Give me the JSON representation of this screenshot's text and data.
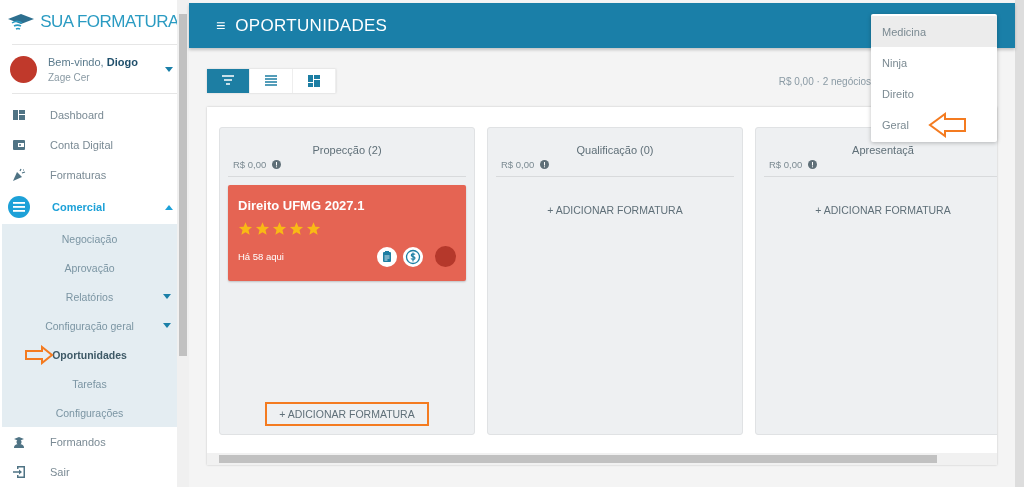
{
  "sidebar": {
    "logo": "SUA FORMATURA",
    "user": {
      "greeting": "Bem-vindo, **Diogo**",
      "company": "Zage Cer"
    },
    "items": [
      {
        "label": "Dashboard",
        "selected": false
      },
      {
        "label": "Conta Digital",
        "selected": false
      },
      {
        "label": "Formaturas",
        "selected": false
      },
      {
        "label": "Comercial",
        "expanded": true,
        "selected": true,
        "children": [
          {
            "label": "Negociação",
            "selected": false,
            "has_submenu": false,
            "annotated": false
          },
          {
            "label": "Aprovação",
            "selected": false,
            "has_submenu": false,
            "annotated": false
          },
          {
            "label": "Relatórios",
            "selected": false,
            "has_submenu": true,
            "annotated": false
          },
          {
            "label": "Configuração geral",
            "selected": false,
            "has_submenu": true,
            "annotated": false
          },
          {
            "label": "Oportunidades",
            "selected": true,
            "has_submenu": false,
            "annotated": true
          },
          {
            "label": "Tarefas",
            "selected": false,
            "has_submenu": false,
            "annotated": false
          },
          {
            "label": "Configurações",
            "selected": false,
            "has_submenu": false,
            "annotated": false
          }
        ]
      },
      {
        "label": "Formandos",
        "selected": false
      },
      {
        "label": "Sair",
        "selected": false
      }
    ]
  },
  "header": {
    "menu_icon": "≡",
    "title": "OPORTUNIDADES"
  },
  "view_toggle": [
    {
      "selected": true
    },
    {
      "selected": false
    },
    {
      "selected": false
    }
  ],
  "summary": "R$ 0,00 · 2 negócios",
  "dropdown": {
    "items": [
      {
        "label": "Medicina",
        "selected": true,
        "annotated": false
      },
      {
        "label": "Ninja",
        "selected": false,
        "annotated": false
      },
      {
        "label": "Direito",
        "selected": false,
        "annotated": false
      },
      {
        "label": "Geral",
        "selected": false,
        "annotated": true
      }
    ]
  },
  "columns": [
    {
      "title": "Propecção (2)",
      "total": "R$ 0,00",
      "add_label": "+ ADICIONAR FORMATURA",
      "highlighted": true,
      "cards": [
        {
          "title": "Direito UFMG 2027.1",
          "stars": 5,
          "age": "Há 58 aqui"
        }
      ]
    },
    {
      "title": "Qualificação (0)",
      "total": "R$ 0,00",
      "add_label": "+ ADICIONAR FORMATURA",
      "highlighted": false
    },
    {
      "title": "Apresentaçã",
      "total": "R$ 0,00",
      "add_label": "+ ADICIONAR FORMATURA",
      "highlighted": false
    }
  ]
}
